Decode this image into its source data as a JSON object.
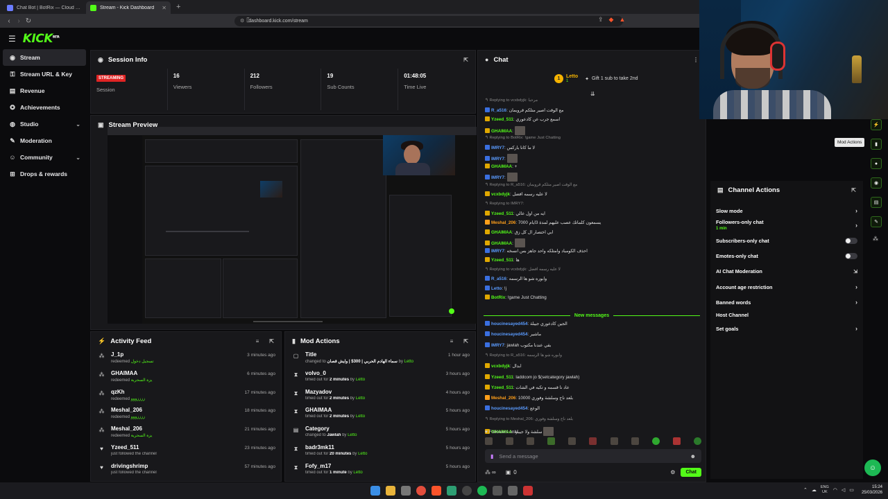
{
  "browser": {
    "tabs": [
      {
        "title": "Chat Bot | BotRix — Cloud Streaming",
        "active": false
      },
      {
        "title": "Stream - Kick Dashboard",
        "active": true
      }
    ],
    "new_tab": "+",
    "url": "dashboard.kick.com/stream"
  },
  "header": {
    "logo": "KICK",
    "logo_sup": "BETA"
  },
  "sidebar": {
    "items": [
      {
        "label": "Stream",
        "icon": "broadcast-icon",
        "glyph": "◉",
        "active": true
      },
      {
        "label": "Stream URL & Key",
        "icon": "key-icon",
        "glyph": "⚿"
      },
      {
        "label": "Revenue",
        "icon": "revenue-icon",
        "glyph": "▤"
      },
      {
        "label": "Achievements",
        "icon": "trophy-icon",
        "glyph": "✪"
      },
      {
        "label": "Studio",
        "icon": "studio-icon",
        "glyph": "◍",
        "chevron": true
      },
      {
        "label": "Moderation",
        "icon": "wrench-icon",
        "glyph": "✎"
      },
      {
        "label": "Community",
        "icon": "community-icon",
        "glyph": "☺",
        "chevron": true
      },
      {
        "label": "Drops & rewards",
        "icon": "gift-icon",
        "glyph": "⊞"
      }
    ]
  },
  "session": {
    "title": "Session Info",
    "status_badge": "STREAMING",
    "stats": [
      {
        "value": "",
        "label": "Session"
      },
      {
        "value": "16",
        "label": "Viewers"
      },
      {
        "value": "212",
        "label": "Followers"
      },
      {
        "value": "19",
        "label": "Sub Counts"
      },
      {
        "value": "01:48:05",
        "label": "Time Live"
      }
    ]
  },
  "preview": {
    "title": "Stream Preview"
  },
  "activity": {
    "title": "Activity Feed",
    "rows": [
      {
        "name": "J_1p",
        "action": "redeemed",
        "reward": "تسجيل دخول",
        "time": "3 minutes ago",
        "icon": "reward-icon"
      },
      {
        "name": "GHAIMAA",
        "action": "redeemed",
        "reward": "يزة السحرية",
        "time": "6 minutes ago",
        "icon": "reward-icon"
      },
      {
        "name": "qzKh",
        "action": "redeemed",
        "reward": "ززززووو",
        "time": "17 minutes ago",
        "icon": "reward-icon"
      },
      {
        "name": "Meshal_206",
        "action": "redeemed",
        "reward": "ززززووو",
        "time": "18 minutes ago",
        "icon": "reward-icon"
      },
      {
        "name": "Meshal_206",
        "action": "redeemed",
        "reward": "يزة السحرية",
        "time": "21 minutes ago",
        "icon": "reward-icon"
      },
      {
        "name": "Yzeed_511",
        "action": "just followed the channel",
        "reward": "",
        "time": "23 minutes ago",
        "icon": "heart-icon"
      },
      {
        "name": "drivingshrimp",
        "action": "just followed the channel",
        "reward": "",
        "time": "57 minutes ago",
        "icon": "heart-icon"
      }
    ]
  },
  "modactions": {
    "title": "Mod Actions",
    "rows": [
      {
        "name": "Title",
        "pre": "changed to",
        "detail": "سماء الهادم الحربي | 300$ | وايش قصان",
        "by_word": "by",
        "by": "Letto",
        "time": "1 hour ago",
        "icon": "title-icon"
      },
      {
        "name": "volvo_0",
        "pre": "timed out for",
        "detail": "2 minutes",
        "by_word": "by",
        "by": "Letto",
        "time": "3 hours ago",
        "icon": "hourglass-icon"
      },
      {
        "name": "Mazyadov",
        "pre": "timed out for",
        "detail": "2 minutes",
        "by_word": "by",
        "by": "Letto",
        "time": "4 hours ago",
        "icon": "hourglass-icon"
      },
      {
        "name": "GHAIMAA",
        "pre": "timed out for",
        "detail": "2 minutes",
        "by_word": "by",
        "by": "Letto",
        "time": "5 hours ago",
        "icon": "hourglass-icon"
      },
      {
        "name": "Category",
        "pre": "changed to",
        "detail": "Jawlah",
        "by_word": "by",
        "by": "Letto",
        "time": "5 hours ago",
        "icon": "category-icon"
      },
      {
        "name": "badr3mk11",
        "pre": "timed out for",
        "detail": "20 minutes",
        "by_word": "by",
        "by": "Letto",
        "time": "5 hours ago",
        "icon": "hourglass-icon"
      },
      {
        "name": "Fofy_m17",
        "pre": "timed out for",
        "detail": "1 minute",
        "by_word": "by",
        "by": "Letto",
        "time": "5 hours ago",
        "icon": "hourglass-icon"
      }
    ]
  },
  "chat": {
    "title": "Chat",
    "pinned": {
      "badge": "1",
      "user": "Letto",
      "sub": "1",
      "gift_text": "Gift 1 sub to take 2nd"
    },
    "messages": [
      {
        "reply": "Replying to vcxbdyjk: مرحبا"
      },
      {
        "user": "R_a516",
        "color": "#5b9cff",
        "text": "مع الوقت اصير متلكم قروبمان"
      },
      {
        "user": "Yzeed_511",
        "color": "#53fc18",
        "text": "اسمع جرب عن كادعوري"
      },
      {
        "user": "GHAIMAA",
        "color": "#53fc18",
        "text": "",
        "emote": true
      },
      {
        "reply": "Replying to BotRix: !game Just Chatting"
      },
      {
        "user": "IMRY7",
        "color": "#5b9cff",
        "text": "لا ما كانا باركس"
      },
      {
        "user": "IMRY7",
        "color": "#5b9cff",
        "text": "",
        "emote": true
      },
      {
        "user": "GHAIMAA",
        "color": "#53fc18",
        "text": "+"
      },
      {
        "user": "IMRY7",
        "color": "#5b9cff",
        "text": "",
        "emote": true
      },
      {
        "reply": "Replying to R_a516: مع الوقت اصير متلكم قروبمان"
      },
      {
        "user": "vcxbdyjk",
        "color": "#53fc18",
        "text": "لا عليه رسمه افضل"
      },
      {
        "reply": "Replying to IMRY7:"
      },
      {
        "user": "Yzeed_511",
        "color": "#53fc18",
        "text": "ايه من اول عالي"
      },
      {
        "user": "Meshal_206",
        "color": "#ff9f1a",
        "text": "يسمعون كلماتك عصب عليهم لمدة 3ايام 7000"
      },
      {
        "user": "GHAIMAA",
        "color": "#53fc18",
        "text": "ابي اختصار ال كل زق"
      },
      {
        "user": "GHAIMAA",
        "color": "#53fc18",
        "text": "",
        "emote": true
      },
      {
        "user": "IMRY7",
        "color": "#5b9cff",
        "text": "احذف الكومباد وامتلكه واحد جاهز بس انسخه"
      },
      {
        "user": "Yzeed_511",
        "color": "#53fc18",
        "text": "ها"
      },
      {
        "reply": "Replying to vcxbdyjk: لا عليه رسمه افضل"
      },
      {
        "user": "R_a516",
        "color": "#5b9cff",
        "text": "وابوره شو ها الرسمه"
      },
      {
        "user": "Letto",
        "color": "#5b9cff",
        "text": "!j"
      },
      {
        "user": "BotRix",
        "color": "#53fc18",
        "text": "!game Just Chatting"
      },
      {
        "user": "houcinesayed454",
        "color": "#5b9cff",
        "text": "الجين كادعوري جيبلة"
      },
      {
        "user": "houcinesayed454",
        "color": "#5b9cff",
        "text": "ماشير"
      },
      {
        "user": "IMRY7",
        "color": "#5b9cff",
        "text": "jawlah بقي عندنا مكتوب"
      },
      {
        "reply": "Replying to R_a516: وابوره شو ها الرسمه"
      },
      {
        "user": "vcxbdyjk",
        "color": "#53fc18",
        "text": "ابدال"
      },
      {
        "user": "Yzeed_511",
        "color": "#53fc18",
        "text": "laddcom jo $(setcategory jawlah)"
      },
      {
        "user": "Yzeed_511",
        "color": "#53fc18",
        "text": "عاد نا قسمه و تكبه في الشات"
      },
      {
        "user": "Meshal_206",
        "color": "#ff9f1a",
        "text": "بلعد ناج وسلشة وفوري 10000"
      },
      {
        "user": "houcinesayed454",
        "color": "#5b9cff",
        "text": "الوعع"
      },
      {
        "reply": "Replying to Meshal_206: بلعد ناج وسلشة وفوري"
      },
      {
        "user": "GHAIMAA",
        "color": "#53fc18",
        "text": "سلشة ولا جيبلة",
        "emote": true
      }
    ],
    "new_messages": "New messages",
    "followers_only": "Followers only",
    "input_placeholder": "Send a message",
    "points": "∞",
    "count": "0",
    "send_label": "Chat"
  },
  "channel_actions": {
    "title": "Channel Actions",
    "items": [
      {
        "label": "Slow mode",
        "kind": "chevron"
      },
      {
        "label": "Followers-only chat",
        "sub": "1 min",
        "kind": "chevron"
      },
      {
        "label": "Subscribers-only chat",
        "kind": "toggle"
      },
      {
        "label": "Emotes-only chat",
        "kind": "toggle"
      },
      {
        "label": "AI Chat Moderation",
        "kind": "external"
      },
      {
        "label": "Account age restriction",
        "kind": "chevron"
      },
      {
        "label": "Banned words",
        "kind": "chevron"
      },
      {
        "label": "Host Channel",
        "kind": "none"
      },
      {
        "label": "Set goals",
        "kind": "chevron"
      }
    ],
    "tooltip": "Mod Actions"
  },
  "taskbar": {
    "lang_top": "ENG",
    "lang_bottom": "UK",
    "time": "15:24",
    "date": "25/03/2026"
  },
  "colors": {
    "accent": "#53fc18",
    "live": "#e02424",
    "panel": "#18181b"
  }
}
